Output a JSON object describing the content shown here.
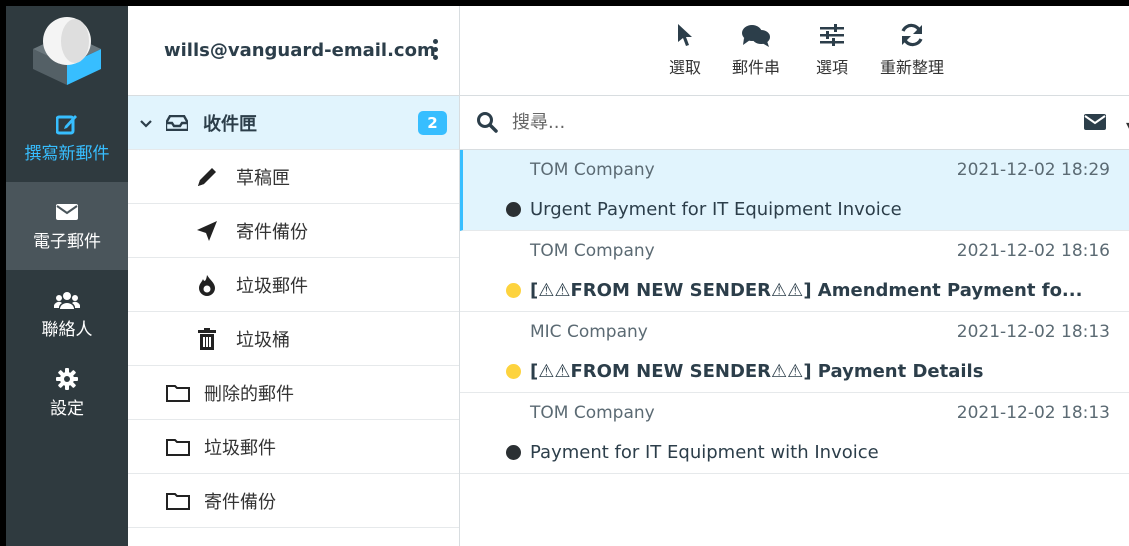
{
  "nav": {
    "compose": "撰寫新郵件",
    "mail": "電子郵件",
    "contacts": "聯絡人",
    "settings": "設定"
  },
  "account": {
    "email": "wills@vanguard-email.com"
  },
  "folders": [
    {
      "name": "收件匣",
      "icon": "inbox-icon",
      "unread": "2"
    },
    {
      "name": "草稿匣",
      "icon": "pencil-icon"
    },
    {
      "name": "寄件備份",
      "icon": "paper-plane-icon"
    },
    {
      "name": "垃圾郵件",
      "icon": "fire-icon"
    },
    {
      "name": "垃圾桶",
      "icon": "trash-icon"
    },
    {
      "name": "刪除的郵件",
      "icon": "folder-icon"
    },
    {
      "name": "垃圾郵件",
      "icon": "folder-icon"
    },
    {
      "name": "寄件備份",
      "icon": "folder-icon"
    }
  ],
  "toolbar": {
    "select": "選取",
    "threads": "郵件串",
    "options": "選項",
    "refresh": "重新整理"
  },
  "search": {
    "placeholder": "搜尋..."
  },
  "messages": [
    {
      "from": "TOM Company",
      "date": "2021-12-02 18:29",
      "subject": "Urgent Payment for IT Equipment Invoice",
      "status": "read",
      "selected": true
    },
    {
      "from": "TOM Company",
      "date": "2021-12-02 18:16",
      "subject": "[⚠⚠FROM NEW SENDER⚠⚠] Amendment Payment fo...",
      "status": "flagged"
    },
    {
      "from": "MIC Company",
      "date": "2021-12-02 18:13",
      "subject": "[⚠⚠FROM NEW SENDER⚠⚠] Payment Details",
      "status": "flagged"
    },
    {
      "from": "TOM Company",
      "date": "2021-12-02 18:13",
      "subject": "Payment for IT Equipment with Invoice",
      "status": "read"
    }
  ],
  "colors": {
    "accent": "#37beff",
    "nav_bg": "#2f3a3f",
    "nav_active": "#4a555b",
    "flag": "#fdd33e",
    "selected_row": "#e1f4fd"
  }
}
